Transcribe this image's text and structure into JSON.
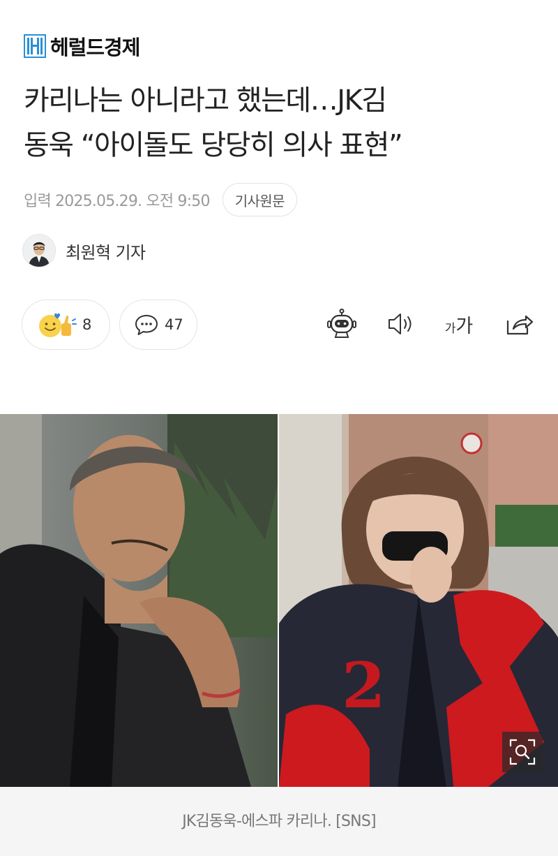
{
  "masthead": {
    "name": "헤럴드경제"
  },
  "article": {
    "headline_line1": "카리나는 아니라고 했는데…JK김",
    "headline_line2": "동욱 “아이돌도 당당히 의사 표현”",
    "published": "입력 2025.05.29. 오전 9:50",
    "original_link_label": "기사원문"
  },
  "author": {
    "name": "최원혁 기자"
  },
  "actions": {
    "reaction_count": "8",
    "comment_count": "47",
    "font_size_small": "가",
    "font_size_large": "가"
  },
  "tools": [
    {
      "icon": "robot-summary-icon"
    },
    {
      "icon": "speaker-icon"
    },
    {
      "icon": "font-size-icon"
    },
    {
      "icon": "share-icon"
    }
  ],
  "photo": {
    "caption": "JK김동욱-에스파 카리나. [SNS]",
    "zoom_icon": "zoom-icon"
  },
  "colors": {
    "brand": "#2a8fd6",
    "text": "#222222",
    "meta_text": "#9a9a9a",
    "caption_bg": "#f5f5f5"
  }
}
